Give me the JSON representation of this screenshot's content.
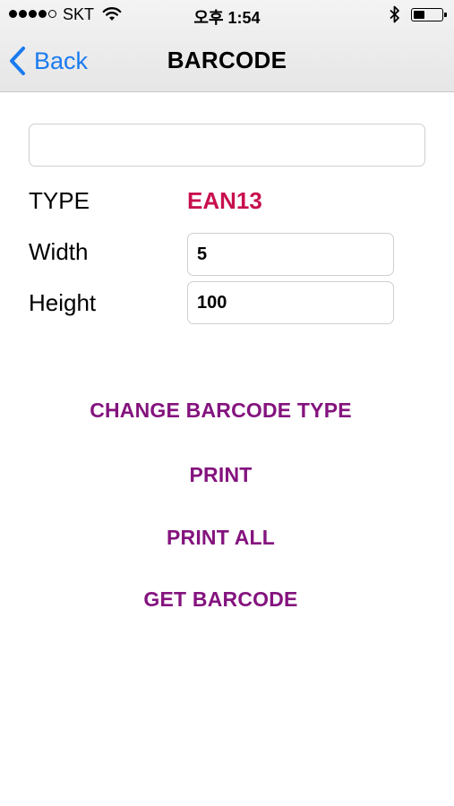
{
  "status_bar": {
    "carrier": "SKT",
    "time": "오후 1:54",
    "signal_bars": 4,
    "signal_max": 5,
    "battery_level": 0.4
  },
  "nav": {
    "back_label": "Back",
    "title": "BARCODE"
  },
  "form": {
    "barcode_value": "",
    "type_label": "TYPE",
    "type_value": "EAN13",
    "width_label": "Width",
    "width_value": "5",
    "height_label": "Height",
    "height_value": "100"
  },
  "actions": {
    "change_type": "CHANGE BARCODE TYPE",
    "print": "PRINT",
    "print_all": "PRINT ALL",
    "get_barcode": "GET BARCODE"
  },
  "colors": {
    "accent_blue": "#1a7bf0",
    "type_value": "#c8104f",
    "action_purple": "#84137e"
  },
  "icons": [
    "back-chevron-icon",
    "wifi-icon",
    "bluetooth-icon",
    "battery-icon",
    "signal-icon"
  ]
}
